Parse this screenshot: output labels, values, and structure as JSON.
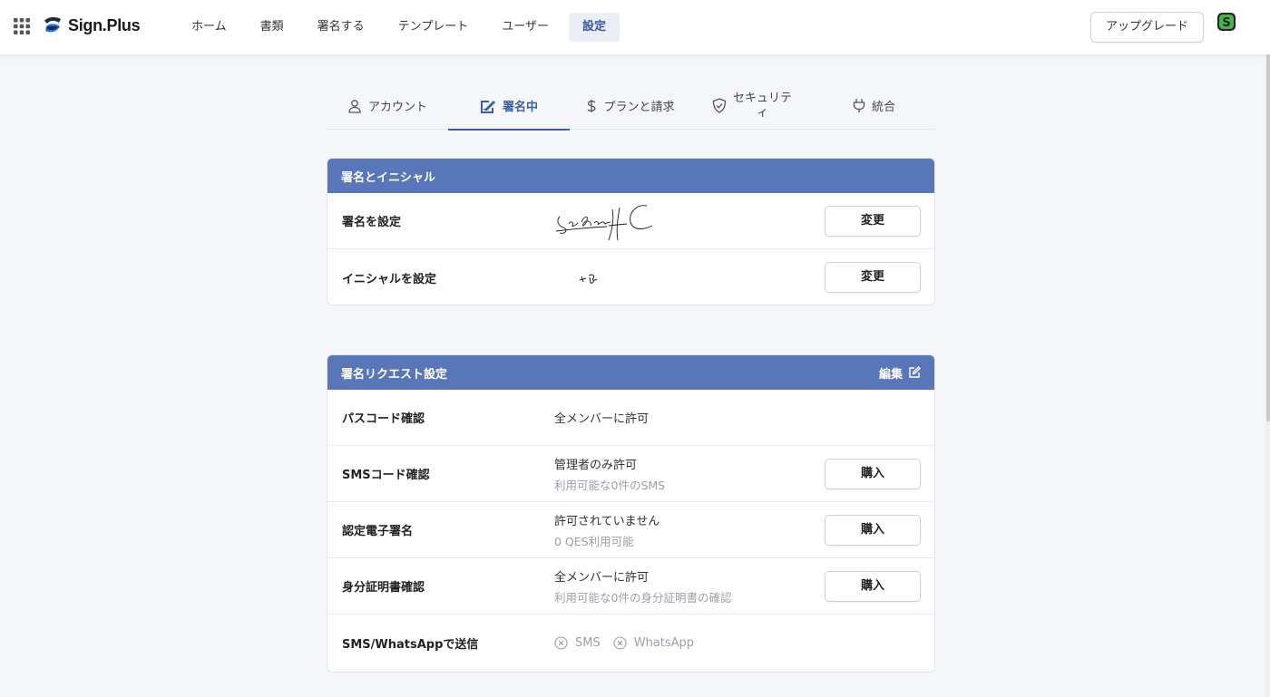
{
  "topbar": {
    "logo_text": "Sign.Plus",
    "nav": [
      "ホーム",
      "書類",
      "署名する",
      "テンプレート",
      "ユーザー",
      "設定"
    ],
    "active_nav": "設定",
    "upgrade_label": "アップグレード",
    "avatar_letter": "S"
  },
  "tabs": [
    {
      "label": "アカウント",
      "icon": "user-icon"
    },
    {
      "label": "署名中",
      "icon": "signature-edit-icon"
    },
    {
      "label": "プランと請求",
      "icon": "dollar-icon"
    },
    {
      "label": "セキュリティ",
      "label_line1": "セキュリテ",
      "label_line2": "ィ",
      "icon": "shield-check-icon"
    },
    {
      "label": "統合",
      "icon": "plug-icon"
    }
  ],
  "active_tab": "署名中",
  "signature_card": {
    "header": "署名とイニシャル",
    "rows": [
      {
        "label": "署名を設定",
        "button": "変更"
      },
      {
        "label": "イニシャルを設定",
        "button": "変更"
      }
    ]
  },
  "request_card": {
    "header": "署名リクエスト設定",
    "edit_label": "編集",
    "rows": [
      {
        "label": "パスコード確認",
        "value": "全メンバーに許可"
      },
      {
        "label": "SMSコード確認",
        "value": "管理者のみ許可",
        "sub": "利用可能な0件のSMS",
        "button": "購入"
      },
      {
        "label": "認定電子署名",
        "value": "許可されていません",
        "sub": "0 QES利用可能",
        "button": "購入"
      },
      {
        "label": "身分証明書確認",
        "value": "全メンバーに許可",
        "sub": "利用可能な0件の身分証明書の確認",
        "button": "購入"
      },
      {
        "label": "SMS/WhatsAppで送信",
        "channels": [
          "SMS",
          "WhatsApp"
        ]
      }
    ]
  },
  "colors": {
    "accent": "#3c5ea8",
    "card_header": "#5976b8",
    "nav_active_bg": "#e9eef7",
    "muted_text": "#9aa0a8"
  }
}
